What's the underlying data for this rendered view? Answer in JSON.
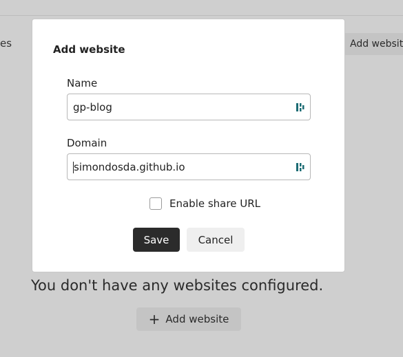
{
  "background": {
    "tab_fragment": "es",
    "add_website_top_label": "Add website",
    "empty_message": "You don't have any websites configured.",
    "add_website_label": "Add website"
  },
  "modal": {
    "title": "Add website",
    "name_label": "Name",
    "name_value": "gp-blog",
    "domain_label": "Domain",
    "domain_value": "simondosda.github.io",
    "share_label": "Enable share URL",
    "share_checked": false,
    "save_label": "Save",
    "cancel_label": "Cancel"
  },
  "icons": {
    "password_manager": "password-manager-icon",
    "plus": "plus-icon"
  },
  "colors": {
    "overlay": "#cfcfcf",
    "primary_button": "#2b2b2b",
    "password_icon": "#1b6b73"
  }
}
